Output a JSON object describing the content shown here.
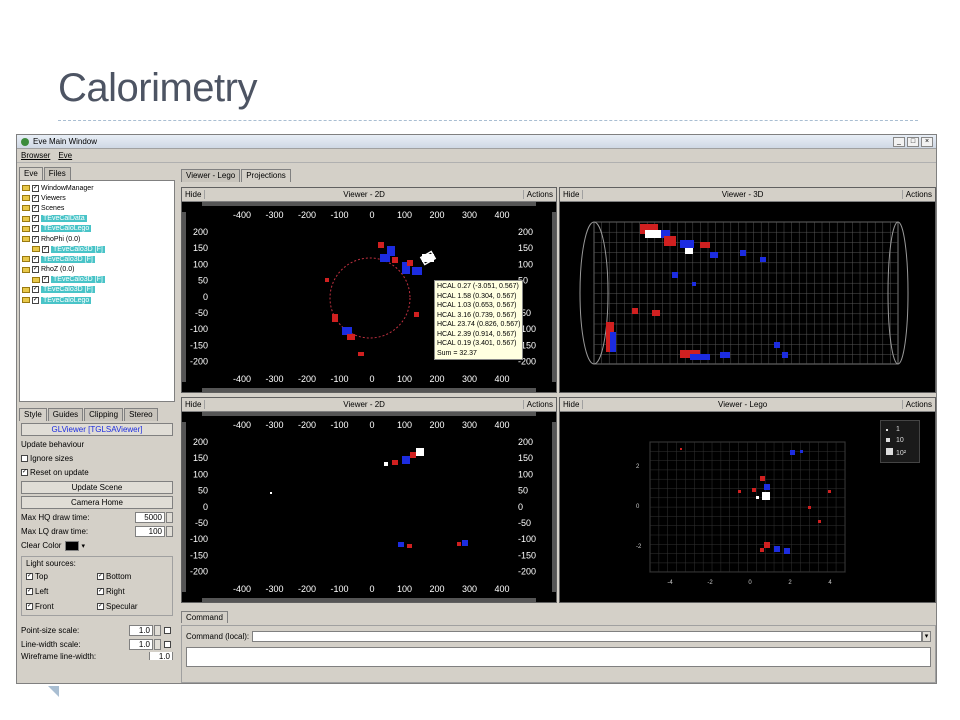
{
  "slide": {
    "title": "Calorimetry"
  },
  "window": {
    "title": "Eve Main Window",
    "controls": [
      "_",
      "□",
      "×"
    ],
    "menu": [
      "Browser",
      "Eve"
    ]
  },
  "left": {
    "tabs": [
      "Eve",
      "Files"
    ],
    "tree": [
      {
        "label": "WindowManager",
        "indent": 0,
        "hl": false
      },
      {
        "label": "Viewers",
        "indent": 0,
        "hl": false
      },
      {
        "label": "Scenes",
        "indent": 0,
        "hl": false
      },
      {
        "label": "TEveCalData",
        "indent": 0,
        "hl": true
      },
      {
        "label": "TEveCaloLego",
        "indent": 0,
        "hl": true
      },
      {
        "label": "RhoPhi (0.0)",
        "indent": 0,
        "hl": false
      },
      {
        "label": "TEveCalo3D [F]",
        "indent": 1,
        "hl": true
      },
      {
        "label": "TEveCalo3D [F]",
        "indent": 0,
        "hl": true
      },
      {
        "label": "RhoZ (0.0)",
        "indent": 0,
        "hl": false
      },
      {
        "label": "TEveCalo3D [F]",
        "indent": 1,
        "hl": true
      },
      {
        "label": "TEveCalo3D [F]",
        "indent": 0,
        "hl": true
      },
      {
        "label": "TEveCaloLego",
        "indent": 0,
        "hl": true
      }
    ],
    "style_tabs": [
      "Style",
      "Guides",
      "Clipping",
      "Stereo"
    ],
    "glviewer_label": "GLViewer [TGLSAViewer]",
    "update_behaviour": "Update behaviour",
    "ignore_sizes": "Ignore sizes",
    "reset_on_update": "Reset on update",
    "update_scene": "Update Scene",
    "camera_home": "Camera Home",
    "max_hq_label": "Max HQ draw time:",
    "max_hq_value": "5000",
    "max_lq_label": "Max LQ draw time:",
    "max_lq_value": "100",
    "clear_color": "Clear Color",
    "light_sources": "Light sources:",
    "lights": [
      "Top",
      "Bottom",
      "Left",
      "Right",
      "Front",
      "Specular"
    ],
    "point_size_label": "Point-size scale:",
    "point_size_value": "1.0",
    "line_width_label": "Line-width scale:",
    "line_width_value": "1.0",
    "wireframe_label": "Wireframe line-width:",
    "wireframe_value": "1.0"
  },
  "viewers": {
    "tabs": [
      "Viewer - Lego",
      "Projections"
    ],
    "hide": "Hide",
    "actions": "Actions",
    "v2d_a": "Viewer - 2D",
    "v3d": "Viewer - 3D",
    "v2d_b": "Viewer - 2D",
    "vlego": "Viewer - Lego"
  },
  "axes": {
    "x_ticks": [
      "-400",
      "-300",
      "-200",
      "-100",
      "0",
      "100",
      "200",
      "300",
      "400"
    ],
    "y_ticks": [
      "200",
      "150",
      "100",
      "50",
      "0",
      "-50",
      "-100",
      "-150",
      "-200"
    ],
    "lego_x": [
      "-4",
      "-2",
      "0",
      "2",
      "4"
    ],
    "lego_y": [
      "2",
      "0",
      "-2"
    ]
  },
  "tooltip": [
    "HCAL 0.27 (-3.051, 0.567)",
    "HCAL 1.58 (0.304, 0.567)",
    "HCAL 1.03 (0.653, 0.567)",
    "HCAL 3.16 (0.739, 0.567)",
    "HCAL 23.74 (0.826, 0.567)",
    "HCAL 2.39 (0.914, 0.567)",
    "HCAL 0.19 (3.401, 0.567)",
    "Sum = 32.37"
  ],
  "lego_legend": [
    "1",
    "10",
    "10²"
  ],
  "command": {
    "tab": "Command",
    "label": "Command (local):"
  },
  "colors": {
    "ecal": "#d02020",
    "hcal": "#1c2ce0",
    "background": "#000000"
  }
}
